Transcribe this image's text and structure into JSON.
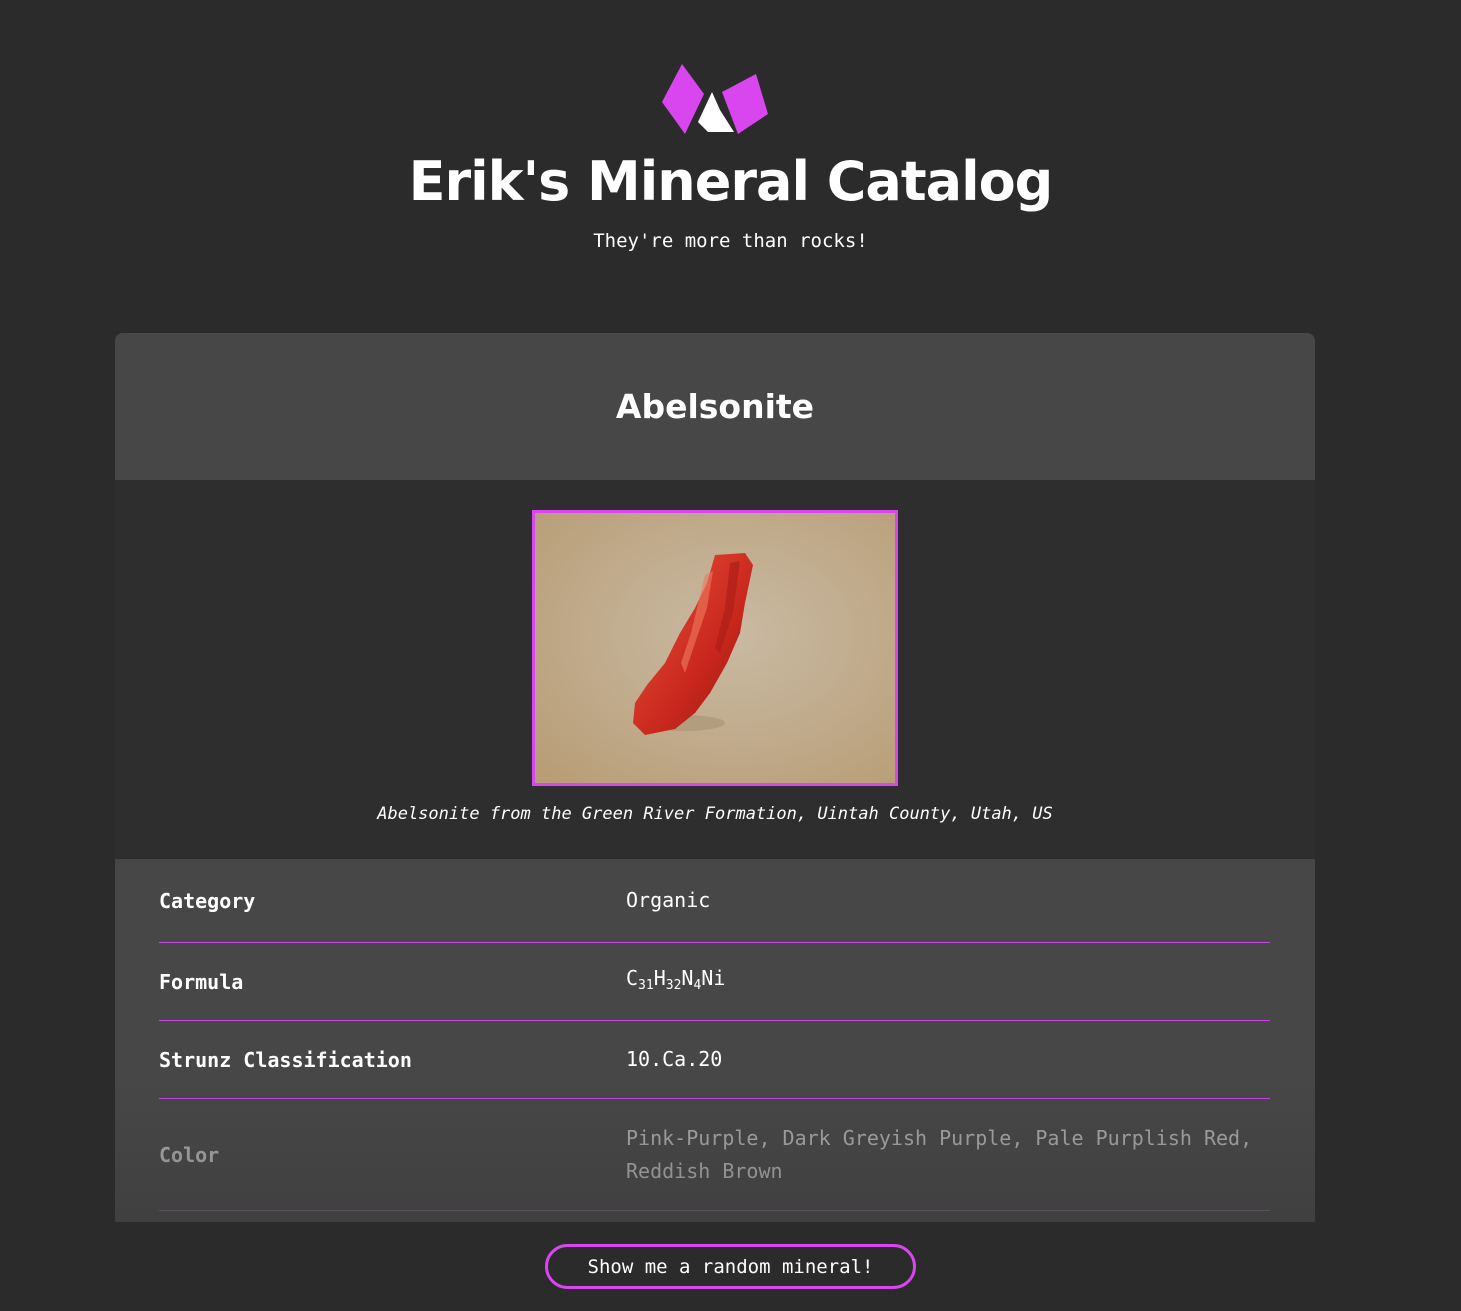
{
  "header": {
    "logo_icon": "crystal-crown-icon",
    "title": "Erik's Mineral Catalog",
    "tagline": "They're more than rocks!"
  },
  "mineral": {
    "name": "Abelsonite",
    "image_caption": "Abelsonite from the Green River Formation, Uintah County, Utah, US",
    "properties": [
      {
        "label": "Category",
        "value": "Organic"
      },
      {
        "label": "Formula",
        "value": "C31H32N4Ni",
        "formula_parts": [
          {
            "el": "C",
            "sub": "31"
          },
          {
            "el": "H",
            "sub": "32"
          },
          {
            "el": "N",
            "sub": "4"
          },
          {
            "el": "Ni",
            "sub": ""
          }
        ]
      },
      {
        "label": "Strunz Classification",
        "value": "10.Ca.20"
      },
      {
        "label": "Color",
        "value": "Pink-Purple, Dark Greyish Purple, Pale Purplish Red, Reddish Brown"
      }
    ]
  },
  "footer": {
    "random_button_label": "Show me a random mineral!"
  },
  "colors": {
    "accent": "#d946ef",
    "background": "#2b2b2b",
    "card": "#474747",
    "media_panel": "#2e2e2e"
  }
}
